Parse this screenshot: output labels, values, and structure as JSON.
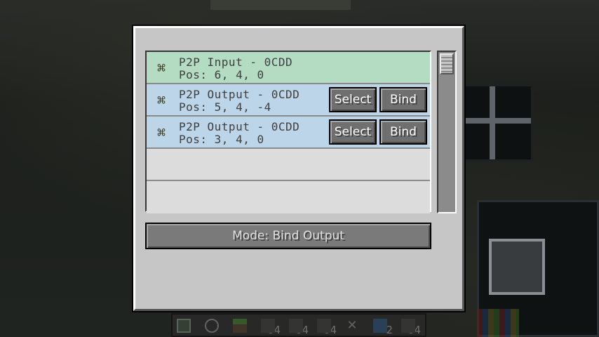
{
  "gui": {
    "entries": [
      {
        "type": "input",
        "title": "P2P Input - 0CDD",
        "pos": "Pos: 6, 4, 0",
        "icon": "p2p-tunnel-icon"
      },
      {
        "type": "output",
        "title": "P2P Output - 0CDD",
        "pos": "Pos: 5, 4, -4",
        "icon": "p2p-tunnel-icon",
        "select_label": "Select",
        "bind_label": "Bind"
      },
      {
        "type": "output",
        "title": "P2P Output - 0CDD",
        "pos": "Pos: 3, 4, 0",
        "icon": "p2p-tunnel-icon",
        "select_label": "Select",
        "bind_label": "Bind"
      }
    ],
    "mode_label": "Mode: Bind Output"
  },
  "hotbar": {
    "slots": [
      {
        "icon": "terminal-icon",
        "count": ""
      },
      {
        "icon": "gear-icon",
        "count": ""
      },
      {
        "icon": "grass-block-icon",
        "count": ""
      },
      {
        "icon": "block-icon",
        "count": "64"
      },
      {
        "icon": "block-icon",
        "count": "64"
      },
      {
        "icon": "block-icon",
        "count": "64"
      },
      {
        "icon": "wrench-icon",
        "count": ""
      },
      {
        "icon": "cable-icon",
        "count": "2"
      },
      {
        "icon": "block-icon",
        "count": "64"
      }
    ]
  },
  "colors": {
    "input_row": "#b4dcc3",
    "output_row": "#bcd5e8",
    "panel": "#c6c6c6"
  }
}
